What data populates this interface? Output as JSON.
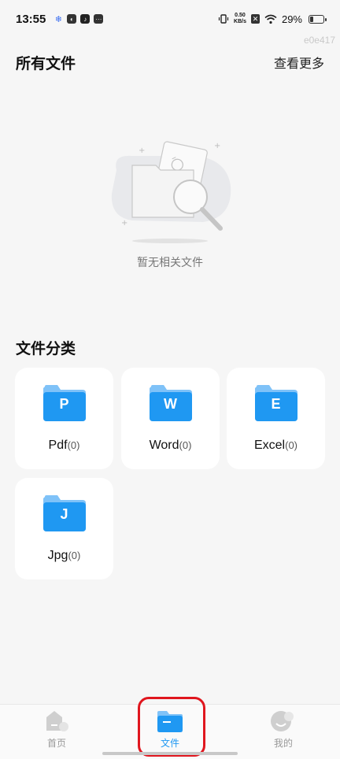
{
  "status_bar": {
    "time": "13:55",
    "net_speed_value": "0.50",
    "net_speed_unit": "KB/s",
    "battery": "29%",
    "battery_level": 0.29
  },
  "watermark": "e0e417",
  "all_files": {
    "title": "所有文件",
    "view_more": "查看更多",
    "empty_text": "暂无相关文件"
  },
  "categories": {
    "title": "文件分类",
    "items": [
      {
        "letter": "P",
        "name": "Pdf",
        "count": "(0)"
      },
      {
        "letter": "W",
        "name": "Word",
        "count": "(0)"
      },
      {
        "letter": "E",
        "name": "Excel",
        "count": "(0)"
      },
      {
        "letter": "J",
        "name": "Jpg",
        "count": "(0)"
      }
    ]
  },
  "bottom_nav": {
    "items": [
      {
        "label": "首页",
        "icon": "home-icon"
      },
      {
        "label": "文件",
        "icon": "folder-icon",
        "active": true
      },
      {
        "label": "我的",
        "icon": "profile-icon"
      }
    ]
  },
  "colors": {
    "accent": "#1f98f2",
    "highlight": "#e0161e"
  }
}
